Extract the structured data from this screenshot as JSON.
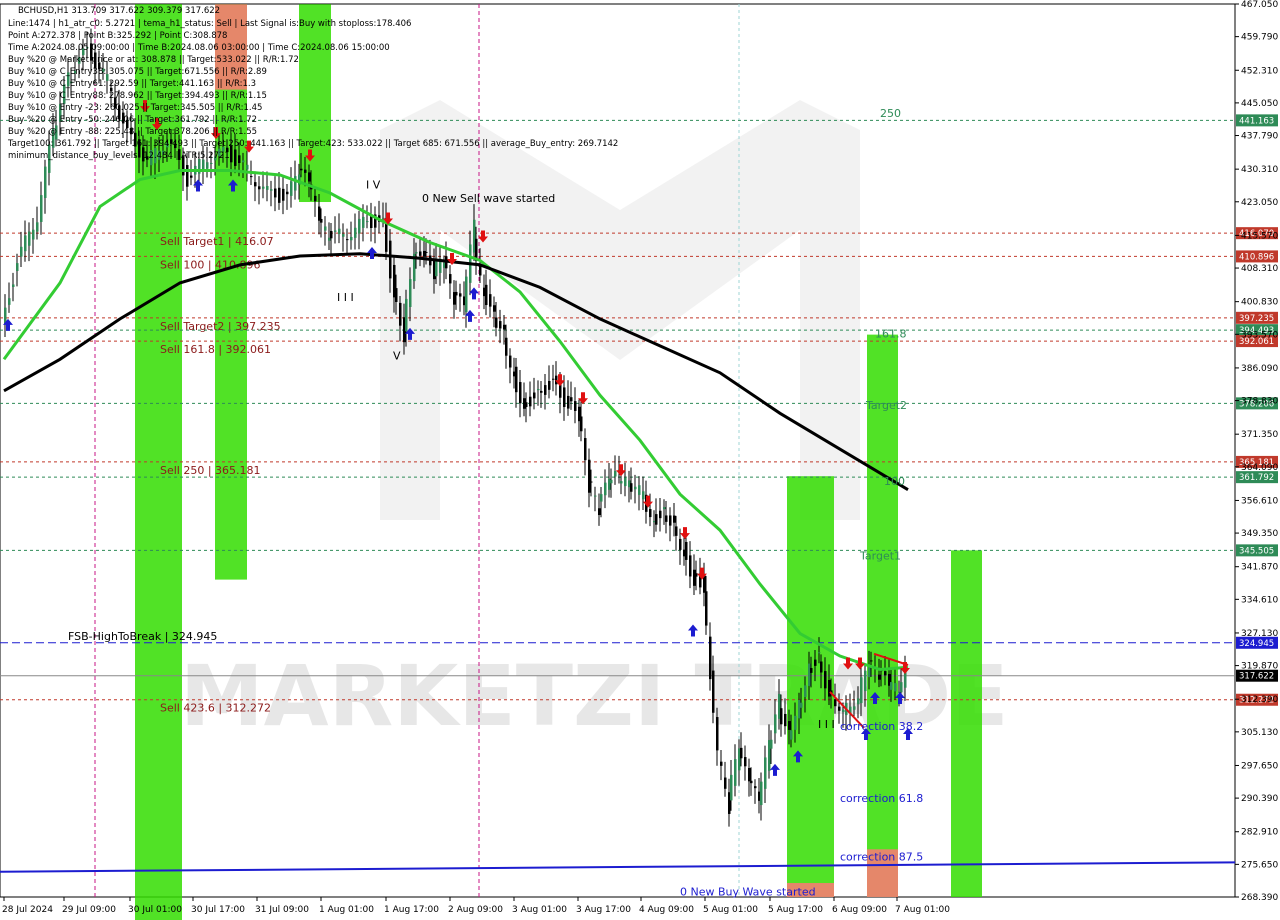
{
  "chart_data": {
    "type": "candlestick",
    "symbol_line": "BCHUSD,H1  313.709 317.622 309.379 317.622",
    "info_lines": [
      "Line:1474 | h1_atr_c0: 5.2721 | tema_h1_status: Sell | Last Signal is:Buy with stoploss:178.406",
      "Point A:272.378 | Point B:325.292 | Point C:308.878",
      "Time A:2024.08.05 09:00:00 | Time B:2024.08.06 03:00:00 | Time C:2024.08.06 15:00:00",
      "Buy %20 @ Market price or at: 308.878 || Target:533.022 || R/R:1.72",
      "Buy %10 @ C_Entry38: 305.075 || Target:671.556 || R/R:2.89",
      "Buy %10 @ C_Entry61: 292.59 || Target:441.163 || R/R:1.3",
      "Buy %10 @ C_Entry88: 278.962 || Target:394.493 || R/R:1.15",
      "Buy %10 @ Entry -23: 260.025 || Target:345.505 || R/R:1.45",
      "Buy %20 @ Entry -50: 246.06 || Target:361.792 || R/R:1.72",
      "Buy %20 @ Entry -88: 225.48 || Target:378.206 || R/R:1.55",
      "Target100: 361.792 || Target 161: 394.493 || Target 250: 441.163 || Target:423: 533.022 || Target 685: 671.556 || average_Buy_entry: 269.7142",
      "minimum_distance_buy_levels: 12.484 | ATR:5.2721"
    ],
    "y_axis": {
      "min": 268.39,
      "max": 467.05,
      "ticks": [
        "467.050",
        "459.790",
        "452.310",
        "445.050",
        "437.790",
        "430.310",
        "423.050",
        "415.570",
        "408.310",
        "400.830",
        "393.570",
        "386.090",
        "378.830",
        "371.350",
        "364.090",
        "356.610",
        "349.350",
        "341.870",
        "334.610",
        "327.130",
        "319.870",
        "312.390",
        "305.130",
        "297.650",
        "290.390",
        "282.910",
        "275.650",
        "268.390"
      ]
    },
    "x_axis": {
      "ticks": [
        "28 Jul 2024",
        "29 Jul 09:00",
        "30 Jul 01:00",
        "30 Jul 17:00",
        "31 Jul 09:00",
        "1 Aug 01:00",
        "1 Aug 17:00",
        "2 Aug 09:00",
        "3 Aug 01:00",
        "3 Aug 17:00",
        "4 Aug 09:00",
        "5 Aug 01:00",
        "5 Aug 17:00",
        "6 Aug 09:00",
        "7 Aug 01:00"
      ]
    },
    "levels": [
      {
        "label": "Sell Target1 | 416.07",
        "value": 416.07,
        "badge": "416.070",
        "color": "#c0392b",
        "label_color": "#8b1a1a"
      },
      {
        "label": "Sell 100 | 410.896",
        "value": 410.896,
        "badge": "410.896",
        "color": "#c0392b",
        "label_color": "#8b1a1a"
      },
      {
        "label": "Sell Target2 | 397.235",
        "value": 397.235,
        "badge": "397.235",
        "color": "#c0392b",
        "label_color": "#8b1a1a"
      },
      {
        "label": "",
        "value": 394.493,
        "badge": "394.493",
        "color": "#2e8b57",
        "label_color": "#2e8b57"
      },
      {
        "label": "Sell 161.8 | 392.061",
        "value": 392.061,
        "badge": "392.061",
        "color": "#c0392b",
        "label_color": "#8b1a1a"
      },
      {
        "label": "",
        "value": 378.206,
        "badge": "378.206",
        "color": "#2e8b57",
        "label_color": "#2e8b57"
      },
      {
        "label": "Sell 250 | 365.181",
        "value": 365.181,
        "badge": "365.181",
        "color": "#c0392b",
        "label_color": "#8b1a1a"
      },
      {
        "label": "",
        "value": 361.792,
        "badge": "361.792",
        "color": "#2e8b57",
        "label_color": "#2e8b57"
      },
      {
        "label": "",
        "value": 345.505,
        "badge": "345.505",
        "color": "#2e8b57",
        "label_color": "#2e8b57"
      },
      {
        "label": "FSB-HighToBreak | 324.945",
        "value": 324.945,
        "badge": "324.945",
        "color": "#1c1cd0",
        "label_color": "#000000"
      },
      {
        "label": "",
        "value": 317.622,
        "badge": "317.622",
        "color": "#888888",
        "label_color": "#000000"
      },
      {
        "label": "Sell 423.6 | 312.272",
        "value": 312.272,
        "badge": "312.272",
        "color": "#c0392b",
        "label_color": "#8b1a1a"
      },
      {
        "label": "",
        "value": 441.163,
        "badge": "441.163",
        "color": "#2e8b57",
        "label_color": "#2e8b57"
      }
    ],
    "annotations": [
      {
        "text": "250",
        "color": "#2e8b57"
      },
      {
        "text": "161.8",
        "color": "#2e8b57"
      },
      {
        "text": "Target2",
        "color": "#2e8b57"
      },
      {
        "text": "100",
        "color": "#2e8b57"
      },
      {
        "text": "Target1",
        "color": "#2e8b57"
      },
      {
        "text": "correction 38.2",
        "color": "#1c1cd0"
      },
      {
        "text": "correction 61.8",
        "color": "#1c1cd0"
      },
      {
        "text": "correction 87.5",
        "color": "#1c1cd0"
      },
      {
        "text": "0 New Sell wave started",
        "color": "#000000"
      },
      {
        "text": "0 New Buy Wave started",
        "color": "#1c1cd0"
      },
      {
        "text": "I V",
        "color": "#000000"
      },
      {
        "text": "V",
        "color": "#000000"
      },
      {
        "text": "I I I",
        "color": "#000000"
      },
      {
        "text": "I I I",
        "color": "#000000"
      }
    ],
    "watermark": "MARKETZI TRADE",
    "colors": {
      "up": "#2e8b57",
      "down": "#000000",
      "ma_fast": "#33cc33",
      "ma_slow": "#000000",
      "buy_arrow": "#1c1cd0",
      "sell_arrow": "#e01010",
      "band_green": "#33dd00",
      "band_red": "#ff7777"
    }
  }
}
